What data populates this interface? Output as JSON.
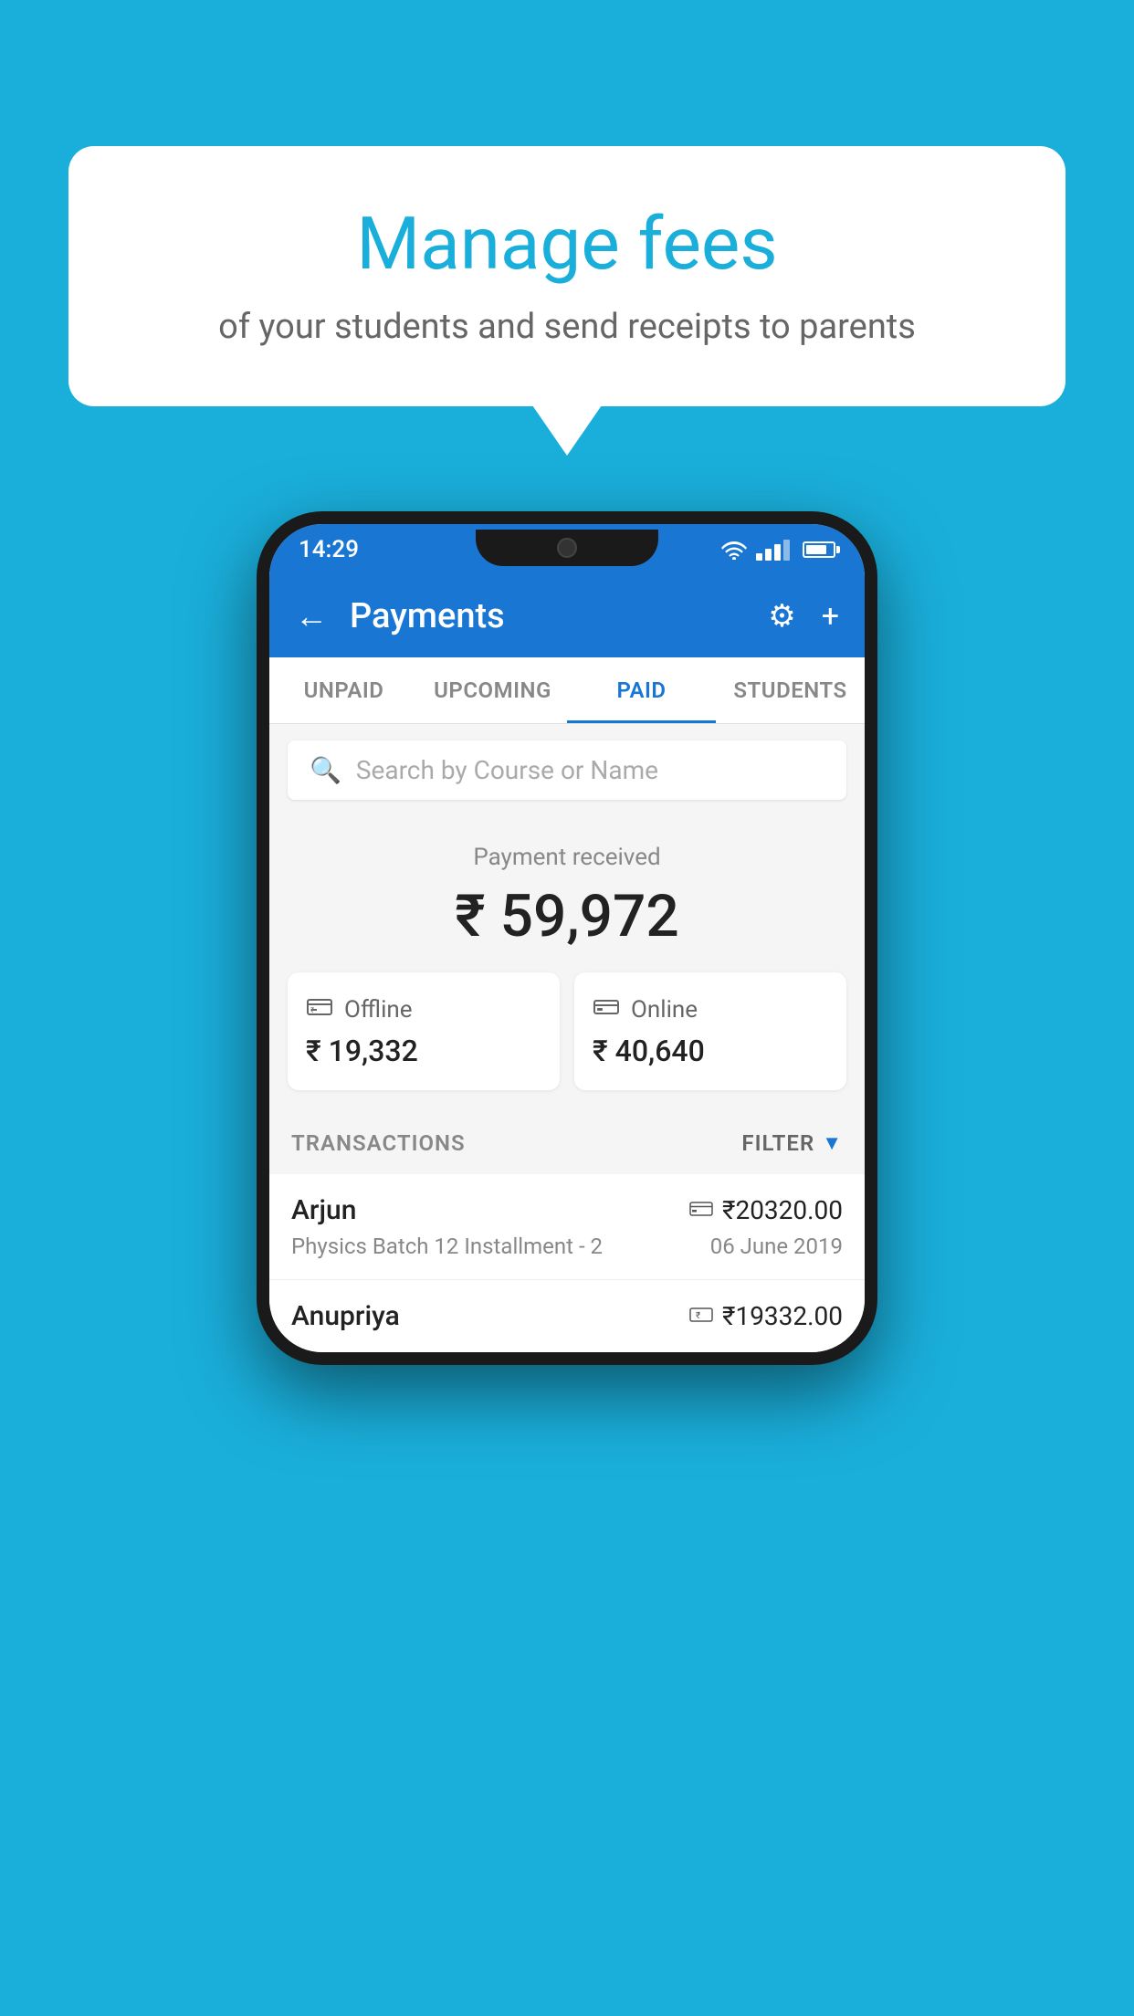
{
  "background_color": "#1AAFDB",
  "bubble": {
    "title": "Manage fees",
    "subtitle": "of your students and send receipts to parents"
  },
  "status_bar": {
    "time": "14:29"
  },
  "app_bar": {
    "title": "Payments",
    "back_label": "←",
    "gear_label": "⚙",
    "plus_label": "+"
  },
  "tabs": [
    {
      "label": "UNPAID",
      "active": false
    },
    {
      "label": "UPCOMING",
      "active": false
    },
    {
      "label": "PAID",
      "active": true
    },
    {
      "label": "STUDENTS",
      "active": false
    }
  ],
  "search": {
    "placeholder": "Search by Course or Name"
  },
  "payment_summary": {
    "label": "Payment received",
    "total": "₹ 59,972",
    "offline_label": "Offline",
    "offline_amount": "₹ 19,332",
    "online_label": "Online",
    "online_amount": "₹ 40,640"
  },
  "transactions_section": {
    "label": "TRANSACTIONS",
    "filter_label": "FILTER"
  },
  "transactions": [
    {
      "name": "Arjun",
      "description": "Physics Batch 12 Installment - 2",
      "amount": "₹20320.00",
      "date": "06 June 2019",
      "mode": "card"
    },
    {
      "name": "Anupriya",
      "description": "",
      "amount": "₹19332.00",
      "date": "",
      "mode": "offline"
    }
  ]
}
